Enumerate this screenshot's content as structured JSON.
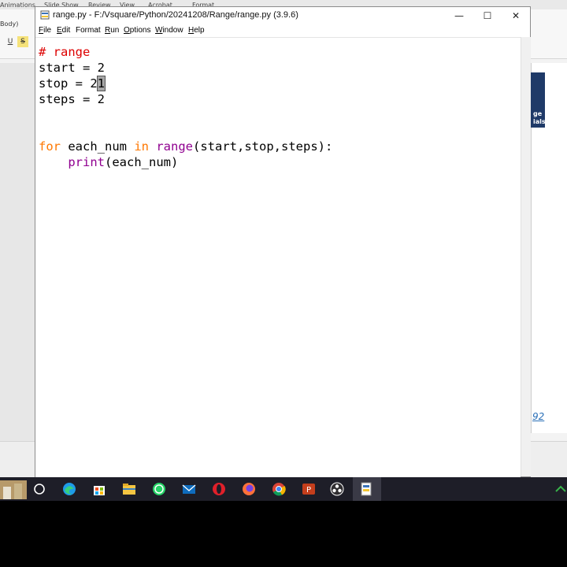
{
  "background_app": {
    "ribbon_tabs": [
      "Animations",
      "Slide Show",
      "Review",
      "View",
      "Acrobat",
      "Format"
    ],
    "font_label": "Body)",
    "underline_btn": "U",
    "strike_btn": "S",
    "slide_number": "92",
    "slide_text": [
      "ge",
      "ials"
    ]
  },
  "window": {
    "title": "range.py - F:/Vsquare/Python/20241208/Range/range.py (3.9.6)",
    "controls": {
      "minimize": "—",
      "maximize": "☐",
      "close": "✕"
    }
  },
  "menu": [
    {
      "hot": "F",
      "rest": "ile"
    },
    {
      "hot": "E",
      "rest": "dit"
    },
    {
      "hot": "",
      "rest": "Format"
    },
    {
      "hot": "R",
      "rest": "un"
    },
    {
      "hot": "O",
      "rest": "ptions"
    },
    {
      "hot": "W",
      "rest": "indow"
    },
    {
      "hot": "H",
      "rest": "elp"
    }
  ],
  "code": {
    "line1": "# range",
    "line2": "start = 2",
    "line3_prefix": "stop = 2",
    "line3_selected": "1",
    "line4": "steps = 2",
    "line7_kw_for": "for",
    "line7_var": " each_num ",
    "line7_kw_in": "in",
    "line7_space": " ",
    "line7_fn": "range",
    "line7_args": "(start,stop,steps):",
    "line8_indent": "    ",
    "line8_fn": "print",
    "line8_args": "(each_num)"
  },
  "taskbar": {
    "icons": [
      "search-icon",
      "edge-icon",
      "store-icon",
      "file-explorer-icon",
      "whatsapp-icon",
      "mail-icon",
      "opera-icon",
      "firefox-icon",
      "chrome-icon",
      "powerpoint-icon",
      "obs-icon",
      "idle-icon"
    ]
  }
}
